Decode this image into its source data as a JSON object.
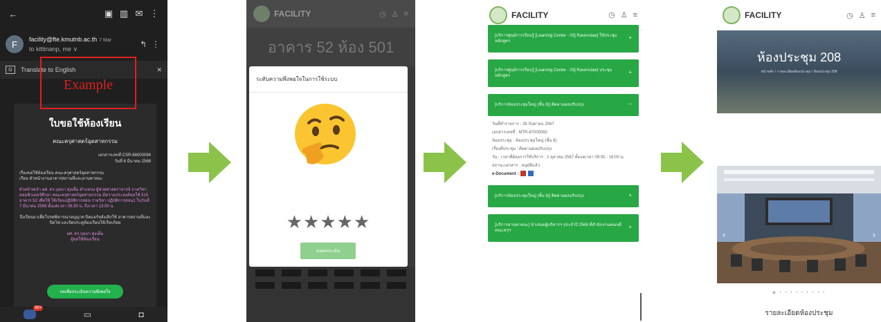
{
  "panel1": {
    "sender": "facility@fte.kmutnb.ac.th",
    "time": "7 Mar",
    "to": "to kittinanp, me ∨",
    "avatar_letter": "F",
    "translate": "Translate to English",
    "annotation": "Example",
    "mail_title": "ใบขอใช้ห้องเรียน",
    "faculty": "คณะครุศาสตร์อุตสาหกรรม",
    "doc_no": "เอกสารเลขที่ CSR-68000094",
    "doc_date": "วันที่ 6 มีนาคม 2568",
    "subject": "เรื่องขอใช้ห้องเรียน คณะครุศาสตร์อุตสาหกรรม",
    "to_line": "เรียน หัวหน้างานอาคารสถานที่และยานพาหนะ",
    "body_pink": "ด้วยข้าพเจ้า ผศ. ดร.บุษบา ตุ่งเต็ม ตำแหน่ง ผู้ช่วยศาสตราจารย์ ภาควิชาคอมพิวเตอร์ศึกษา คณะครุศาสตร์อุตสาหกรรม มีความประสงค์ขอใช้ 515 อาคาร 52 เพื่อใช้ ใช้เรียนปฏิบัติการสอน รายวิชา ปฏิบัติการสอน1 ในวันที่ 7 มีนาคม 2568 ตั้งแต่เวลา 08:30 น. ถึงเวลา 13:00 น.",
    "body_end": "จึงเรียนมาเพื่อโปรดพิจารณาอนุญาต ปิดแอร์หลังเลิกใช้ อาคารสถานที่และปิดไฟ และปิดประตูห้องเรียนให้เรียบร้อย",
    "signer": "ผศ. ดร.บุษบา ตุ่งเต็ม",
    "signer_role": "ผู้ขอใช้ห้องเรียน",
    "action_button": "กดเพื่อประเมินความพึงพอใจ",
    "badge": "99+"
  },
  "panel2": {
    "brand": "FACILITY",
    "hero": "อาคาร 52 ห้อง 501",
    "modal_title": "ระดับความพึงพอใจในการใช้ระบบ",
    "stars": "★★★★★",
    "submit": "ส่งผลประเมิน"
  },
  "panel3": {
    "brand": "FACILITY",
    "notifications": [
      {
        "text": "[บริการศูนย์การเรียนรู้ [Learning Center - 03] Ravenclaw] ใช้ประชุมหลักสูตร"
      },
      {
        "text": "[บริการศูนย์การเรียนรู้ [Learning Center - 03] Ravenclaw] ประชุมหลักสูตร"
      },
      {
        "text": "[บริการห้องประชุมใหญ่ (ชั้น 8)] ติดตามผลปรับปรุง"
      }
    ],
    "detail": {
      "date": "วันที่ทำรายการ : 26 กันยายน 2567",
      "doc": "เอกสารเลขที่ : MTR-67000082",
      "room": "ห้องประชุม : ห้องประชุมใหญ่ (ชั้น 8)",
      "topic": "เรื่องที่ประชุม : ติดตามผลปรับปรุง",
      "time": "วัน - เวลาที่ต้องการใช้บริการ : 1 ตุลาคม 2567 ตั้งแต่เวลา 09:00 - 16:00 น.",
      "status": "สถานะเอกสาร : อนุมัติแล้ว",
      "edoc": "e-Document :"
    },
    "notifications_after": [
      {
        "text": "[บริการห้องประชุมใหญ่ (ชั้น 8)] ติดตามผลปรับปรุง"
      },
      {
        "text": "[บริการยานพาหนะ] นำเสนอผู้บริหารฯ ประจำปี 2568 ที่สำนักงานคณบดีคณะครุฯ"
      }
    ]
  },
  "panel4": {
    "brand": "FACILITY",
    "hero_title": "ห้องประชุม 208",
    "breadcrumb": "หน้าหลัก / รายละเอียดห้องประชุม / ห้องประชุม 208",
    "dots": "◉ • • • • • • • • •",
    "section_heading": "รายละเอียดห้องประชุม"
  }
}
